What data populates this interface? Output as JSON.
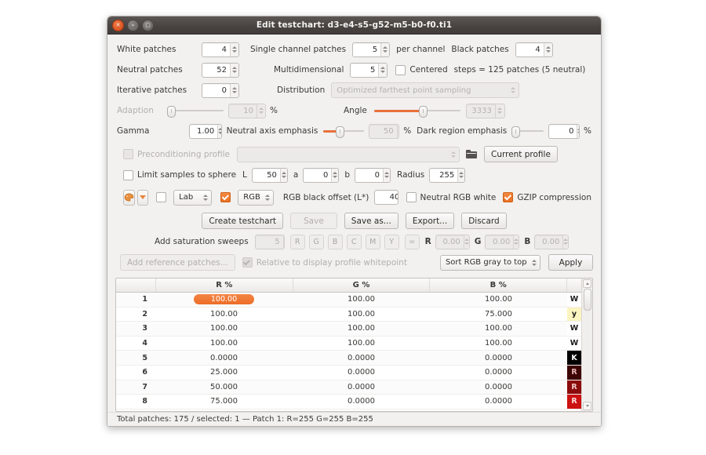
{
  "window": {
    "title": "Edit testchart: d3-e4-s5-g52-m5-b0-f0.ti1",
    "close_icon": "close-icon",
    "minimize_icon": "minimize-icon",
    "maximize_icon": "maximize-icon"
  },
  "form": {
    "white_patches_label": "White patches",
    "white_patches_value": "4",
    "single_channel_label": "Single channel patches",
    "single_channel_value": "5",
    "per_channel_label": "per channel",
    "black_patches_label": "Black patches",
    "black_patches_value": "4",
    "neutral_patches_label": "Neutral patches",
    "neutral_patches_value": "52",
    "multidimensional_label": "Multidimensional",
    "multidimensional_value": "5",
    "centered_label": "Centered",
    "steps_text": "steps = 125 patches (5 neutral)",
    "iterative_patches_label": "Iterative patches",
    "iterative_patches_value": "0",
    "distribution_label": "Distribution",
    "distribution_value": "Optimized farthest point sampling",
    "adaption_label": "Adaption",
    "adaption_value": "10",
    "adaption_unit": "%",
    "angle_label": "Angle",
    "angle_value": "3333",
    "gamma_label": "Gamma",
    "gamma_value": "1.00",
    "neutral_axis_label": "Neutral axis emphasis",
    "neutral_axis_value": "50",
    "neutral_axis_unit": "%",
    "dark_region_label": "Dark region emphasis",
    "dark_region_value": "0",
    "dark_region_unit": "%",
    "precond_label": "Preconditioning profile",
    "precond_value": "",
    "folder_icon": "folder-icon",
    "current_profile_label": "Current profile",
    "limit_sphere_label": "Limit samples to sphere",
    "L_label": "L",
    "L_value": "50",
    "a_label": "a",
    "a_value": "0",
    "b_label": "b",
    "b_value": "0",
    "radius_label": "Radius",
    "radius_value": "255",
    "palette_icon": "color-palette-icon",
    "dropdown_icon": "chevron-down-icon",
    "lab_value": "Lab",
    "rgb_value": "RGB",
    "rgb_black_offset_label": "RGB black offset (L*)",
    "rgb_black_offset_value": "40",
    "neutral_rgb_white_label": "Neutral RGB white",
    "gzip_label": "GZIP compression"
  },
  "buttons": {
    "create_testchart": "Create testchart",
    "save": "Save",
    "save_as": "Save as...",
    "export": "Export...",
    "discard": "Discard"
  },
  "saturation": {
    "label": "Add saturation sweeps",
    "count": "5",
    "channels": [
      "R",
      "G",
      "B",
      "C",
      "M",
      "Y"
    ],
    "equals": "=",
    "r_label": "R",
    "r_value": "0.00",
    "g_label": "G",
    "g_value": "0.00",
    "b_label": "B",
    "b_value": "0.00"
  },
  "reference": {
    "add_reference_label": "Add reference patches...",
    "relative_label": "Relative to display profile whitepoint",
    "sort_value": "Sort RGB gray to top",
    "apply_label": "Apply"
  },
  "table": {
    "headers": [
      "",
      "R %",
      "G %",
      "B %"
    ],
    "rows": [
      {
        "idx": "1",
        "r": "100.00",
        "g": "100.00",
        "b": "100.00",
        "sw": "W",
        "sw_bg": "#ffffff",
        "sw_fg": "#1c1b1a",
        "selected": true
      },
      {
        "idx": "2",
        "r": "100.00",
        "g": "100.00",
        "b": "75.000",
        "sw": "y",
        "sw_bg": "#fbf4c0",
        "sw_fg": "#1c1b1a",
        "selected": false
      },
      {
        "idx": "3",
        "r": "100.00",
        "g": "100.00",
        "b": "100.00",
        "sw": "W",
        "sw_bg": "#ffffff",
        "sw_fg": "#1c1b1a",
        "selected": false
      },
      {
        "idx": "4",
        "r": "100.00",
        "g": "100.00",
        "b": "100.00",
        "sw": "W",
        "sw_bg": "#ffffff",
        "sw_fg": "#1c1b1a",
        "selected": false
      },
      {
        "idx": "5",
        "r": "0.0000",
        "g": "0.0000",
        "b": "0.0000",
        "sw": "K",
        "sw_bg": "#000000",
        "sw_fg": "#ffffff",
        "selected": false
      },
      {
        "idx": "6",
        "r": "25.000",
        "g": "0.0000",
        "b": "0.0000",
        "sw": "R",
        "sw_bg": "#3d0505",
        "sw_fg": "#e8b9b9",
        "selected": false
      },
      {
        "idx": "7",
        "r": "50.000",
        "g": "0.0000",
        "b": "0.0000",
        "sw": "R",
        "sw_bg": "#8b0b0b",
        "sw_fg": "#f0c8c8",
        "selected": false
      },
      {
        "idx": "8",
        "r": "75.000",
        "g": "0.0000",
        "b": "0.0000",
        "sw": "R",
        "sw_bg": "#cc1111",
        "sw_fg": "#ffdede",
        "selected": false
      }
    ]
  },
  "status": {
    "text": "Total patches: 175 / selected: 1 — Patch 1: R=255 G=255 B=255"
  },
  "colors": {
    "accent": "#e8703a",
    "titlebar": "#494442",
    "window_bg": "#f2f1f0"
  }
}
